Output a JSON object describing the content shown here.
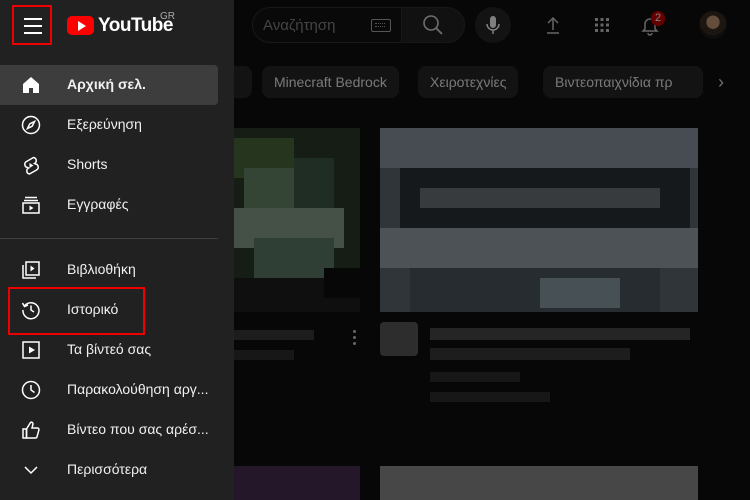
{
  "brand": {
    "name": "YouTube",
    "region": "GR"
  },
  "search": {
    "placeholder": "Αναζήτηση"
  },
  "notifications": {
    "count": "2"
  },
  "chips": [
    "Minecraft Bedrock",
    "Χειροτεχνίες",
    "Βιντεοπαιχνίδια πρ"
  ],
  "sidebar": {
    "section1": [
      {
        "label": "Αρχική σελ.",
        "icon": "home-icon",
        "active": true
      },
      {
        "label": "Εξερεύνηση",
        "icon": "compass-icon"
      },
      {
        "label": "Shorts",
        "icon": "shorts-icon"
      },
      {
        "label": "Εγγραφές",
        "icon": "subscriptions-icon"
      }
    ],
    "section2": [
      {
        "label": "Βιβλιοθήκη",
        "icon": "library-icon"
      },
      {
        "label": "Ιστορικό",
        "icon": "history-icon"
      },
      {
        "label": "Τα βίντεό σας",
        "icon": "your-videos-icon"
      },
      {
        "label": "Παρακολούθηση αργ...",
        "icon": "watch-later-icon"
      },
      {
        "label": "Βίντεο που σας αρέσ...",
        "icon": "liked-icon"
      },
      {
        "label": "Περισσότερα",
        "icon": "chevron-down-icon"
      }
    ]
  },
  "colors": {
    "brand_red": "#ff0000",
    "highlight": "#e00000",
    "sidebar_bg": "#212121",
    "page_bg": "#0f0f0f"
  }
}
